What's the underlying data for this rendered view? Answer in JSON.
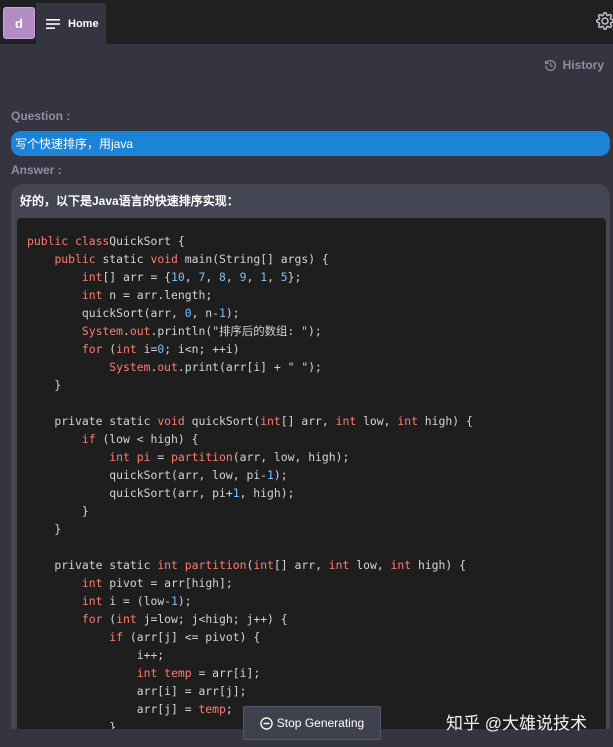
{
  "topbar": {
    "avatar_letter": "d",
    "home_label": "Home"
  },
  "history_label": "History",
  "question_label": "Question :",
  "question_text": "写个快速排序，用java",
  "answer_label": "Answer :",
  "answer_intro": "好的，以下是Java语言的快速排序实现：",
  "code": [
    [
      [
        "kw",
        "public class"
      ],
      [
        "",
        "QuickSort {"
      ]
    ],
    [
      [
        "",
        "    "
      ],
      [
        "kw",
        "public"
      ],
      [
        "",
        " static "
      ],
      [
        "kw",
        "void"
      ],
      [
        "",
        " main(String[] args) {"
      ]
    ],
    [
      [
        "",
        "        "
      ],
      [
        "kw",
        "int"
      ],
      [
        "",
        "[] arr = {"
      ],
      [
        "num",
        "10"
      ],
      [
        "",
        ", "
      ],
      [
        "num",
        "7"
      ],
      [
        "",
        ", "
      ],
      [
        "num",
        "8"
      ],
      [
        "",
        ", "
      ],
      [
        "num",
        "9"
      ],
      [
        "",
        ", "
      ],
      [
        "num",
        "1"
      ],
      [
        "",
        ", "
      ],
      [
        "num",
        "5"
      ],
      [
        "",
        "};"
      ]
    ],
    [
      [
        "",
        "        "
      ],
      [
        "kw",
        "int"
      ],
      [
        "",
        " n = arr.length;"
      ]
    ],
    [
      [
        "",
        "        quickSort(arr, "
      ],
      [
        "num",
        "0"
      ],
      [
        "",
        ", n-"
      ],
      [
        "num",
        "1"
      ],
      [
        "",
        ");"
      ]
    ],
    [
      [
        "",
        "        "
      ],
      [
        "kw",
        "System"
      ],
      [
        "",
        "."
      ],
      [
        "kw",
        "out"
      ],
      [
        "",
        ".println(\"排序后的数组: \");"
      ]
    ],
    [
      [
        "",
        "        "
      ],
      [
        "kw",
        "for"
      ],
      [
        "",
        " ("
      ],
      [
        "kw",
        "int"
      ],
      [
        "",
        " i="
      ],
      [
        "num",
        "0"
      ],
      [
        "",
        "; i<n; ++i)"
      ]
    ],
    [
      [
        "",
        "            "
      ],
      [
        "kw",
        "System"
      ],
      [
        "",
        "."
      ],
      [
        "kw",
        "out"
      ],
      [
        "",
        ".print(arr[i] + \" \");"
      ]
    ],
    [
      [
        "",
        "    }"
      ]
    ],
    [
      [
        "",
        ""
      ]
    ],
    [
      [
        "",
        "    private static "
      ],
      [
        "kw",
        "void"
      ],
      [
        "",
        " quickSort("
      ],
      [
        "kw",
        "int"
      ],
      [
        "",
        "[] arr, "
      ],
      [
        "kw",
        "int"
      ],
      [
        "",
        " low, "
      ],
      [
        "kw",
        "int"
      ],
      [
        "",
        " high) {"
      ]
    ],
    [
      [
        "",
        "        "
      ],
      [
        "kw",
        "if"
      ],
      [
        "",
        " (low < high) {"
      ]
    ],
    [
      [
        "",
        "            "
      ],
      [
        "kw",
        "int"
      ],
      [
        "",
        " "
      ],
      [
        "kw",
        "pi"
      ],
      [
        "",
        " = "
      ],
      [
        "kw",
        "partition"
      ],
      [
        "",
        "(arr, low, high);"
      ]
    ],
    [
      [
        "",
        "            quickSort(arr, low, pi-"
      ],
      [
        "num",
        "1"
      ],
      [
        "",
        ");"
      ]
    ],
    [
      [
        "",
        "            quickSort(arr, pi+"
      ],
      [
        "num",
        "1"
      ],
      [
        "",
        ", high);"
      ]
    ],
    [
      [
        "",
        "        }"
      ]
    ],
    [
      [
        "",
        "    }"
      ]
    ],
    [
      [
        "",
        ""
      ]
    ],
    [
      [
        "",
        "    private static "
      ],
      [
        "kw",
        "int"
      ],
      [
        "",
        " "
      ],
      [
        "kw",
        "partition"
      ],
      [
        "",
        "("
      ],
      [
        "kw",
        "int"
      ],
      [
        "",
        "[] arr, "
      ],
      [
        "kw",
        "int"
      ],
      [
        "",
        " low, "
      ],
      [
        "kw",
        "int"
      ],
      [
        "",
        " high) {"
      ]
    ],
    [
      [
        "",
        "        "
      ],
      [
        "kw",
        "int"
      ],
      [
        "",
        " pivot = arr[high];"
      ]
    ],
    [
      [
        "",
        "        "
      ],
      [
        "kw",
        "int"
      ],
      [
        "",
        " i = (low-"
      ],
      [
        "num",
        "1"
      ],
      [
        "",
        ");"
      ]
    ],
    [
      [
        "",
        "        "
      ],
      [
        "kw",
        "for"
      ],
      [
        "",
        " ("
      ],
      [
        "kw",
        "int"
      ],
      [
        "",
        " j=low; j<high; j++) {"
      ]
    ],
    [
      [
        "",
        "            "
      ],
      [
        "kw",
        "if"
      ],
      [
        "",
        " (arr[j] <= pivot) {"
      ]
    ],
    [
      [
        "",
        "                i++;"
      ]
    ],
    [
      [
        "",
        "                "
      ],
      [
        "kw",
        "int"
      ],
      [
        "",
        " "
      ],
      [
        "kw",
        "temp"
      ],
      [
        "",
        " = arr[i];"
      ]
    ],
    [
      [
        "",
        "                arr[i] = arr[j];"
      ]
    ],
    [
      [
        "",
        "                arr[j] = "
      ],
      [
        "kw",
        "temp"
      ],
      [
        "",
        ";"
      ]
    ],
    [
      [
        "",
        "            }"
      ]
    ]
  ],
  "stop_button_label": "Stop Generating",
  "watermark": "知乎 @大雄说技术",
  "colors": {
    "background": "#343541",
    "topbar": "#202123",
    "question_bg": "#1c84d6",
    "answer_bg": "#444654",
    "code_bg": "#1e1e1e",
    "keyword": "#ff7b72",
    "number": "#79c0ff"
  }
}
